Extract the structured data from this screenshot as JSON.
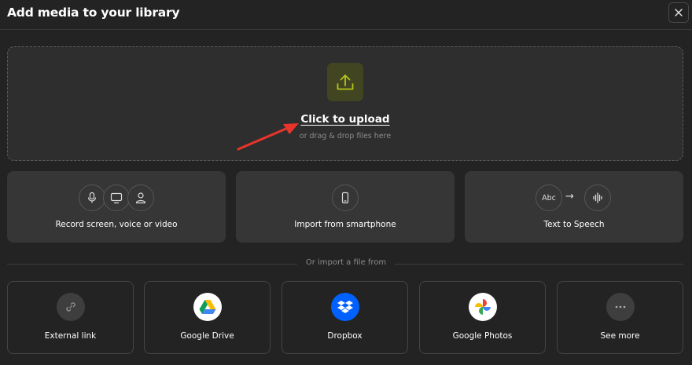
{
  "header": {
    "title": "Add media to your library",
    "close_icon": "close-icon"
  },
  "upload": {
    "icon": "upload-icon",
    "link_label": "Click to upload",
    "hint": "or drag & drop files here",
    "accent_tile_color": "#414521",
    "accent_icon_color": "#b6c21a"
  },
  "options": [
    {
      "label": "Record screen, voice or video",
      "icons": [
        "microphone-icon",
        "monitor-icon",
        "user-icon"
      ]
    },
    {
      "label": "Import from smartphone",
      "icons": [
        "smartphone-icon"
      ]
    },
    {
      "label": "Text to Speech",
      "icons": [
        "abc-text-icon",
        "arrow-right-icon",
        "soundwave-icon"
      ],
      "abc_text": "Abc",
      "arrow_text": "→"
    }
  ],
  "import": {
    "divider_text": "Or import a file from",
    "sources": [
      {
        "label": "External link",
        "icon": "link-icon"
      },
      {
        "label": "Google Drive",
        "icon": "google-drive-icon"
      },
      {
        "label": "Dropbox",
        "icon": "dropbox-icon",
        "color": "#0061fe"
      },
      {
        "label": "Google Photos",
        "icon": "google-photos-icon"
      },
      {
        "label": "See more",
        "icon": "more-icon"
      }
    ]
  },
  "colors": {
    "background": "#232323",
    "panel": "#363636",
    "annotation_arrow": "#e8352b"
  }
}
